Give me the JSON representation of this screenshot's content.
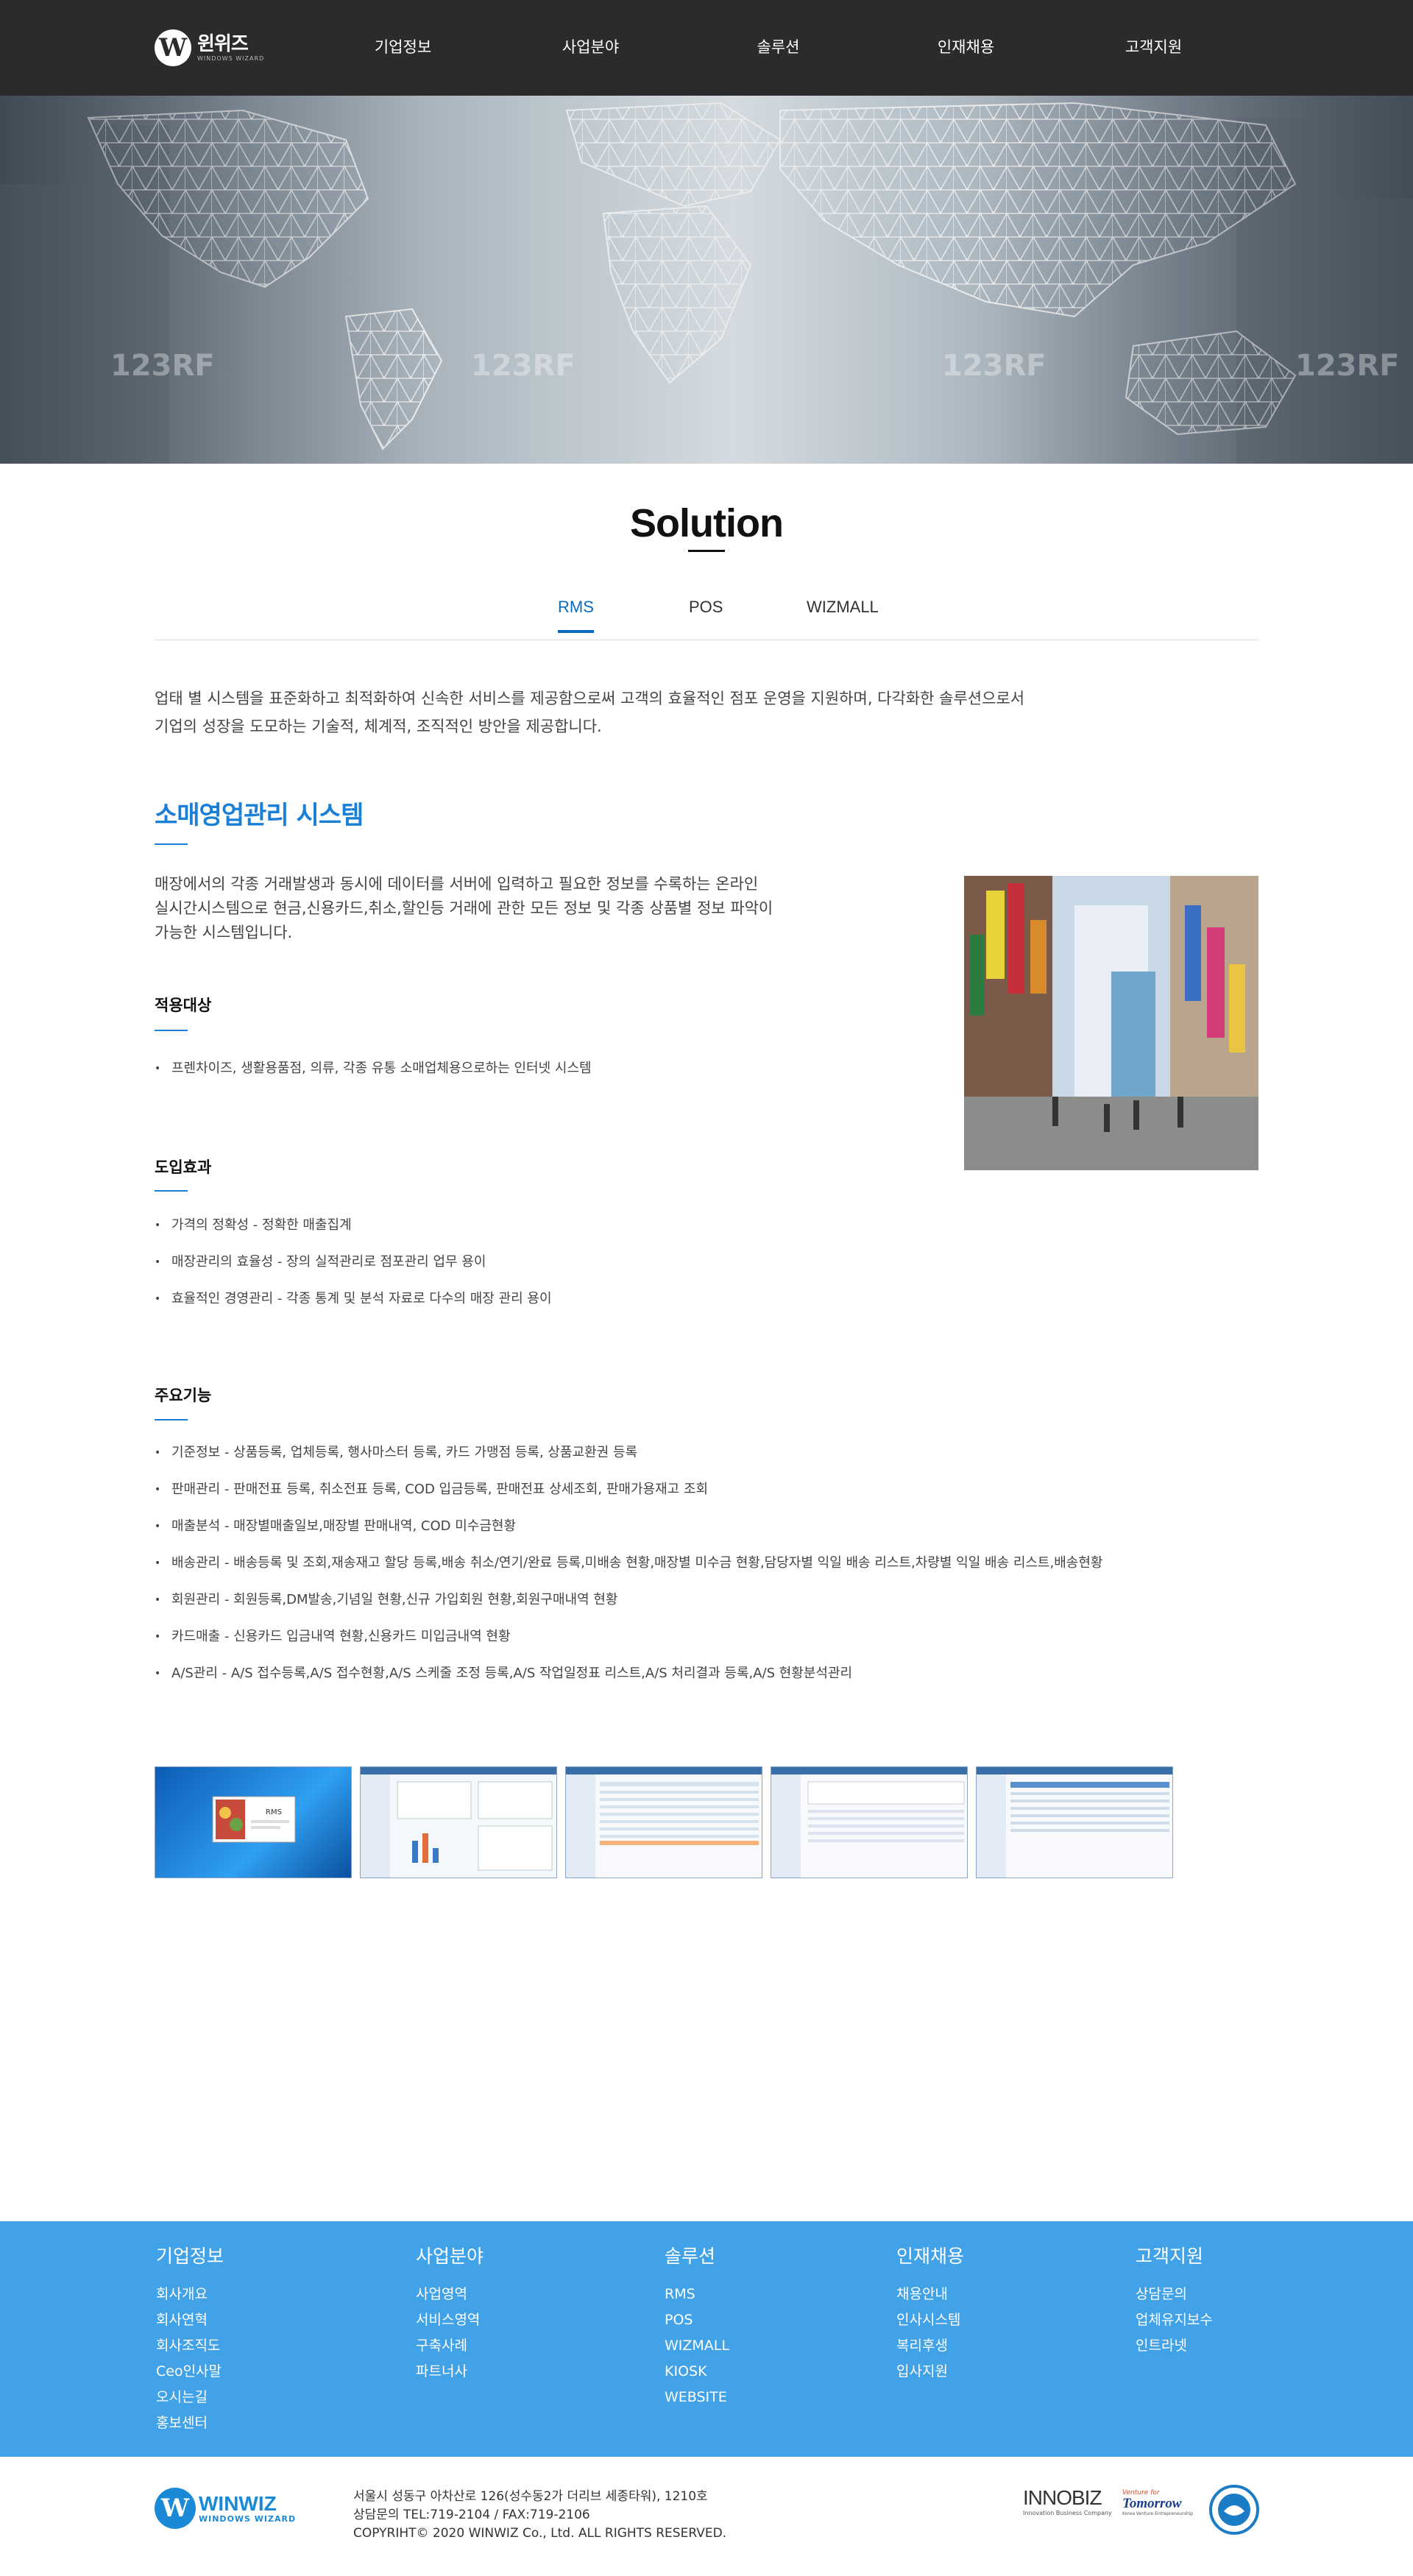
{
  "header": {
    "logo_mark": "W",
    "logo_name": "윈위즈",
    "logo_sub": "WINDOWS WIZARD",
    "nav": [
      "기업정보",
      "사업분야",
      "솔루션",
      "인재채용",
      "고객지원"
    ]
  },
  "hero": {
    "watermark": "123RF"
  },
  "section": {
    "title": "Solution",
    "tabs": [
      {
        "label": "RMS",
        "active": true
      },
      {
        "label": "POS",
        "active": false
      },
      {
        "label": "WIZMALL",
        "active": false
      }
    ],
    "intro_line1": "업태 별 시스템을 표준화하고 최적화하여 신속한 서비스를 제공함으로써 고객의 효율적인 점포 운영을 지원하며, 다각화한 솔루션으로서",
    "intro_line2": "기업의 성장을 도모하는 기술적, 체계적, 조직적인 방안을 제공합니다."
  },
  "rms": {
    "heading": "소매영업관리 시스템",
    "desc_line1": "매장에서의 각종 거래발생과 동시에 데이터를 서버에 입력하고 필요한 정보를 수록하는 온라인",
    "desc_line2": "실시간시스템으로  현금,신용카드,취소,할인등 거래에 관한 모든 정보 및 각종 상품별 정보 파악이",
    "desc_line3": "가능한 시스템입니다.",
    "target_title": "적용대상",
    "target_items": [
      "프렌차이즈, 생활용품점, 의류, 각종 유통 소매업체용으로하는 인터넷 시스템"
    ],
    "effect_title": "도입효과",
    "effect_items": [
      "가격의 정확성 - 정확한 매출집계",
      "매장관리의 효율성 - 장의 실적관리로 점포관리 업무 용이",
      "효율적인 경영관리 - 각종 통계 및 분석 자료로 다수의 매장 관리 용이"
    ],
    "feature_title": "주요기능",
    "feature_items": [
      "기준정보 - 상품등록, 업체등록, 행사마스터 등록, 카드 가맹점 등록, 상품교환권 등록",
      "판매관리 - 판매전표 등록, 취소전표 등록, COD 입금등록, 판매전표 상세조회, 판매가용재고 조회",
      "매출분석 - 매장별매출일보,매장별 판매내역, COD 미수금현황",
      "배송관리 - 배송등록 및 조회,재송재고 할당 등록,배송 취소/연기/완료 등록,미배송 현황,매장별 미수금 현황,담당자별 익일 배송 리스트,차량별 익일 배송 리스트,배송현황",
      "회원관리 - 회원등록,DM발송,기념일 현황,신규 가입회원 현황,회원구매내역 현황",
      "카드매출 - 신용카드 입금내역 현황,신용카드 미입금내역 현황",
      "A/S관리 - A/S 접수등록,A/S 접수현황,A/S 스케줄 조정 등록,A/S 작업일정표 리스트,A/S 처리결과 등록,A/S 현황분석관리"
    ],
    "thumb_label": "RMS"
  },
  "footer": {
    "columns": [
      {
        "title": "기업정보",
        "items": [
          "회사개요",
          "회사연혁",
          "회사조직도",
          "Ceo인사말",
          "오시는길",
          "홍보센터"
        ]
      },
      {
        "title": "사업분야",
        "items": [
          "사업영역",
          "서비스영역",
          "구축사례",
          "파트너사"
        ]
      },
      {
        "title": "솔루션",
        "items": [
          "RMS",
          "POS",
          "WIZMALL",
          "KIOSK",
          "WEBSITE"
        ]
      },
      {
        "title": "인재채용",
        "items": [
          "채용안내",
          "인사시스템",
          "복리후생",
          "입사지원"
        ]
      },
      {
        "title": "고객지원",
        "items": [
          "상담문의",
          "업체유지보수",
          "인트라넷"
        ]
      }
    ],
    "logo_mark": "W",
    "logo_name": "WINWIZ",
    "logo_sub": "WINDOWS WIZARD",
    "address": "서울시 성동구 아차산로 126(성수동2가 더리브 세종타워), 1210호",
    "contact": "상담문의 TEL:719-2104 / FAX:719-2106",
    "copyright": "COPYRIHT© 2020 WINWIZ Co., Ltd. ALL RIGHTS RESERVED.",
    "cert1_name": "INNOBIZ",
    "cert1_sub": "Innovation Business Company",
    "cert2_top": "Venture for",
    "cert2_name": "Tomorrow",
    "cert2_sub": "Korea Venture Entrepreneurship"
  }
}
